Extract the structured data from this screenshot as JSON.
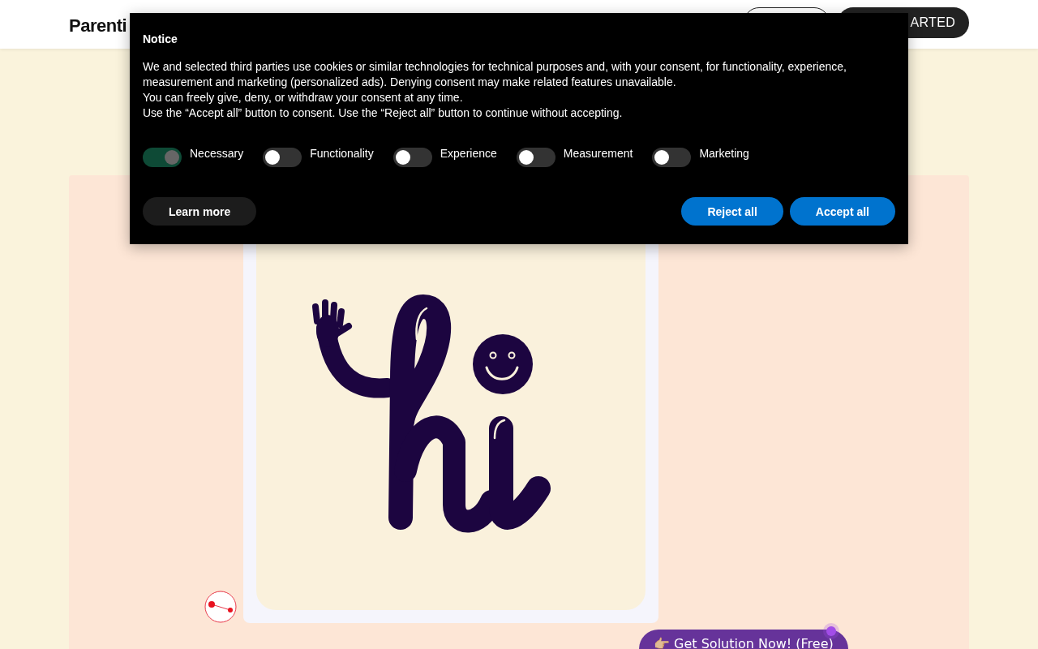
{
  "header": {
    "logo": "Parenti",
    "cta_button": "ARTED"
  },
  "cookie_notice": {
    "title": "Notice",
    "paragraphs": [
      "We and selected third parties use cookies or similar technologies for technical purposes and, with your consent, for functionality, experience, measurement and marketing (personalized ads). Denying consent may make related features unavailable.",
      "You can freely give, deny, or withdraw your consent at any time.",
      "Use the “Accept all” button to consent. Use the “Reject all” button to continue without accepting."
    ],
    "toggles": [
      {
        "label": "Necessary",
        "on": true,
        "disabled": true
      },
      {
        "label": "Functionality",
        "on": false,
        "disabled": false
      },
      {
        "label": "Experience",
        "on": false,
        "disabled": false
      },
      {
        "label": "Measurement",
        "on": false,
        "disabled": false
      },
      {
        "label": "Marketing",
        "on": false,
        "disabled": false
      }
    ],
    "buttons": [
      {
        "label": "Learn more",
        "kind": "secondary"
      },
      {
        "label": "Reject all",
        "kind": "primary"
      },
      {
        "label": "Accept all",
        "kind": "primary"
      }
    ]
  },
  "solution_button": "👉🏼 Get Solution Now! (Free)"
}
